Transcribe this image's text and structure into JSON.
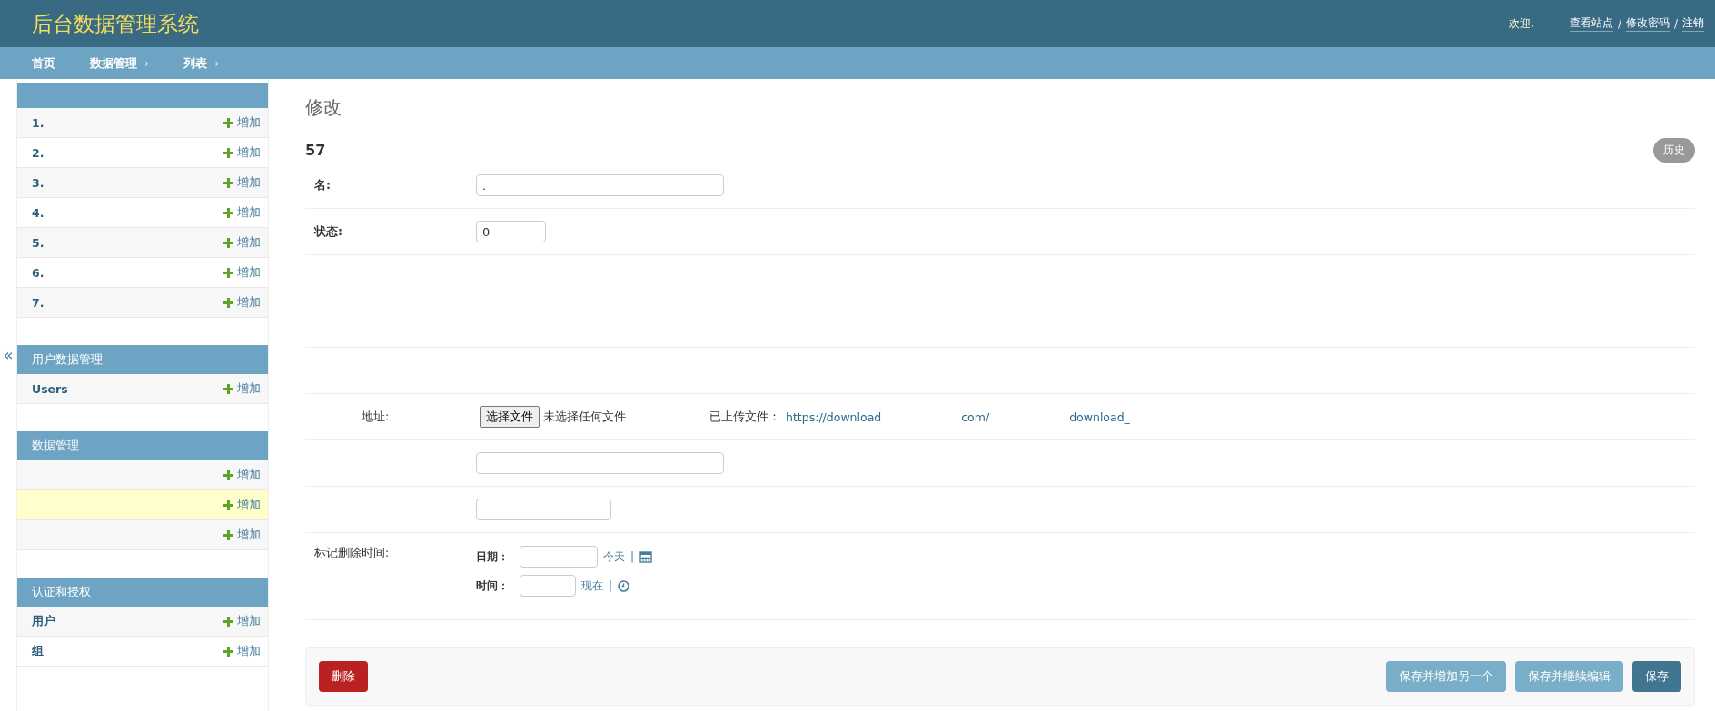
{
  "header": {
    "title": "后台数据管理系统",
    "welcome": "欢迎,",
    "user_links": [
      {
        "kind": "link",
        "label": "查看站点"
      },
      {
        "kind": "sep",
        "label": "/"
      },
      {
        "kind": "link",
        "label": "修改密码"
      },
      {
        "kind": "sep",
        "label": "/"
      },
      {
        "kind": "link",
        "label": "注销"
      }
    ]
  },
  "breadcrumbs": [
    {
      "kind": "link",
      "label": "首页"
    },
    {
      "kind": "link",
      "label": "数据管理"
    },
    {
      "kind": "sep",
      "label": "›"
    },
    {
      "kind": "link",
      "label": "列表"
    },
    {
      "kind": "sep",
      "label": "›"
    }
  ],
  "sidebar": {
    "collapse_toggle": "«",
    "modules": [
      {
        "items": [
          {
            "name": "1.",
            "add_label": "增加",
            "selected": false
          },
          {
            "name": "2.",
            "add_label": "增加",
            "selected": false
          },
          {
            "name": "3.",
            "add_label": "增加",
            "selected": false
          },
          {
            "name": "4.",
            "add_label": "增加",
            "selected": false
          },
          {
            "name": "5.",
            "add_label": "增加",
            "selected": false
          },
          {
            "name": "6.",
            "add_label": "增加",
            "selected": false
          },
          {
            "name": "7.",
            "add_label": "增加",
            "selected": false
          }
        ]
      },
      {
        "title": "用户数据管理",
        "items": [
          {
            "name": "Users",
            "add_label": "增加",
            "selected": false
          }
        ]
      },
      {
        "title": "数据管理",
        "items": [
          {
            "add_label": "增加",
            "selected": false
          },
          {
            "add_label": "增加",
            "selected": true
          },
          {
            "add_label": "增加",
            "selected": false
          }
        ]
      },
      {
        "title": "认证和授权",
        "items": [
          {
            "name": "用户",
            "add_label": "增加",
            "selected": false
          },
          {
            "name": "组",
            "add_label": "增加",
            "selected": false
          }
        ]
      }
    ]
  },
  "content": {
    "heading": "修改",
    "object_title": "57",
    "history_button": "历史",
    "fields": [
      {
        "kind": "text",
        "label": "名:",
        "value": "."
      },
      {
        "kind": "number",
        "label": "状态:",
        "value": "0"
      },
      {
        "kind": "hidden"
      },
      {
        "kind": "hidden"
      },
      {
        "kind": "hidden"
      },
      {
        "kind": "file",
        "label": "地址:",
        "choose_button": "选择文件",
        "file_status": "未选择任何文件",
        "uploaded_label": "已上传文件：",
        "uploaded_parts": [
          "https://download",
          "com/",
          "download_"
        ]
      },
      {
        "kind": "text"
      },
      {
        "kind": "short_text"
      },
      {
        "kind": "datetime",
        "label": "标记删除时间:",
        "date_label": "日期：",
        "today_link": "今天",
        "time_label": "时间：",
        "now_link": "现在",
        "divider": "|"
      }
    ]
  },
  "submit_row": {
    "delete_button": "删除",
    "buttons": [
      "保存并增加另一个",
      "保存并继续编辑",
      "保存"
    ]
  }
}
